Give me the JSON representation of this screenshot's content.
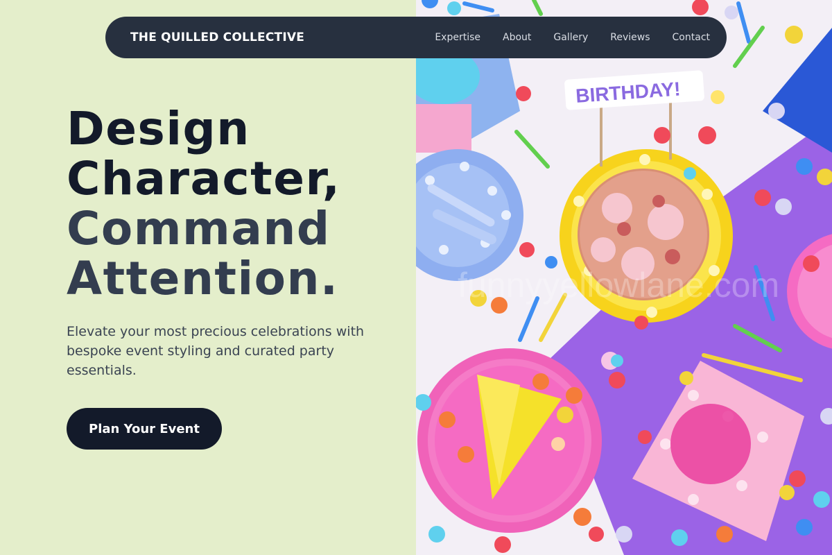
{
  "brand": {
    "name": "THE QUILLED COLLECTIVE"
  },
  "nav": {
    "items": [
      {
        "label": "Expertise"
      },
      {
        "label": "About"
      },
      {
        "label": "Gallery"
      },
      {
        "label": "Reviews"
      },
      {
        "label": "Contact"
      }
    ]
  },
  "hero": {
    "headline_line1": "Design",
    "headline_line2": "Character,",
    "headline_line3": "Command",
    "headline_line4": "Attention.",
    "subtext": "Elevate your most precious celebrations with bespoke event styling and curated party essentials.",
    "cta_label": "Plan Your Event",
    "image_banner_text": "BIRTHDAY!",
    "watermark": "funnyyellowlane.com"
  },
  "colors": {
    "left_background": "#e4eecb",
    "nav_background": "#27303f",
    "headline_dark": "#131a2a",
    "headline_mid": "#333d4f",
    "cta_background": "#131a2a"
  }
}
